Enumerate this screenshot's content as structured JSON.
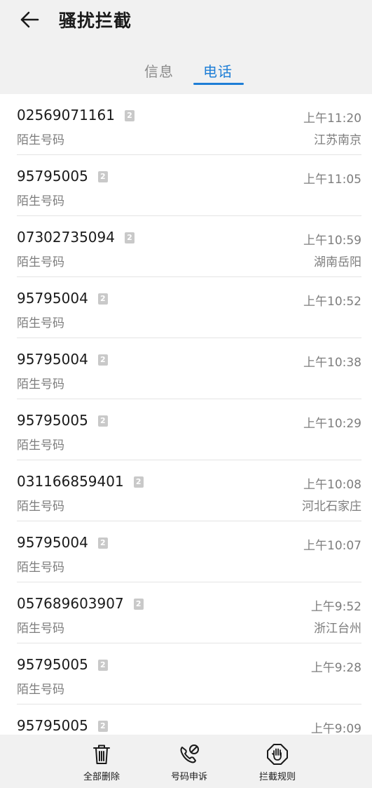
{
  "header": {
    "title": "骚扰拦截"
  },
  "tabs": [
    {
      "label": "信息"
    },
    {
      "label": "电话"
    }
  ],
  "calls": [
    {
      "number": "02569071161",
      "label": "陌生号码",
      "time": "上午11:20",
      "location": "江苏南京"
    },
    {
      "number": "95795005",
      "label": "陌生号码",
      "time": "上午11:05",
      "location": ""
    },
    {
      "number": "07302735094",
      "label": "陌生号码",
      "time": "上午10:59",
      "location": "湖南岳阳"
    },
    {
      "number": "95795004",
      "label": "陌生号码",
      "time": "上午10:52",
      "location": ""
    },
    {
      "number": "95795004",
      "label": "陌生号码",
      "time": "上午10:38",
      "location": ""
    },
    {
      "number": "95795005",
      "label": "陌生号码",
      "time": "上午10:29",
      "location": ""
    },
    {
      "number": "031166859401",
      "label": "陌生号码",
      "time": "上午10:08",
      "location": "河北石家庄"
    },
    {
      "number": "95795004",
      "label": "陌生号码",
      "time": "上午10:07",
      "location": ""
    },
    {
      "number": "057689603907",
      "label": "陌生号码",
      "time": "上午9:52",
      "location": "浙江台州"
    },
    {
      "number": "95795005",
      "label": "陌生号码",
      "time": "上午9:28",
      "location": ""
    },
    {
      "number": "95795005",
      "label": "",
      "time": "上午9:09",
      "location": ""
    }
  ],
  "sim_badge": "2",
  "actions": [
    {
      "label": "全部删除",
      "icon": "trash-icon"
    },
    {
      "label": "号码申诉",
      "icon": "phone-appeal-icon"
    },
    {
      "label": "拦截规则",
      "icon": "hand-stop-icon"
    }
  ],
  "colors": {
    "accent": "#1e7ed6",
    "bar_bg": "#f1f1f1"
  }
}
